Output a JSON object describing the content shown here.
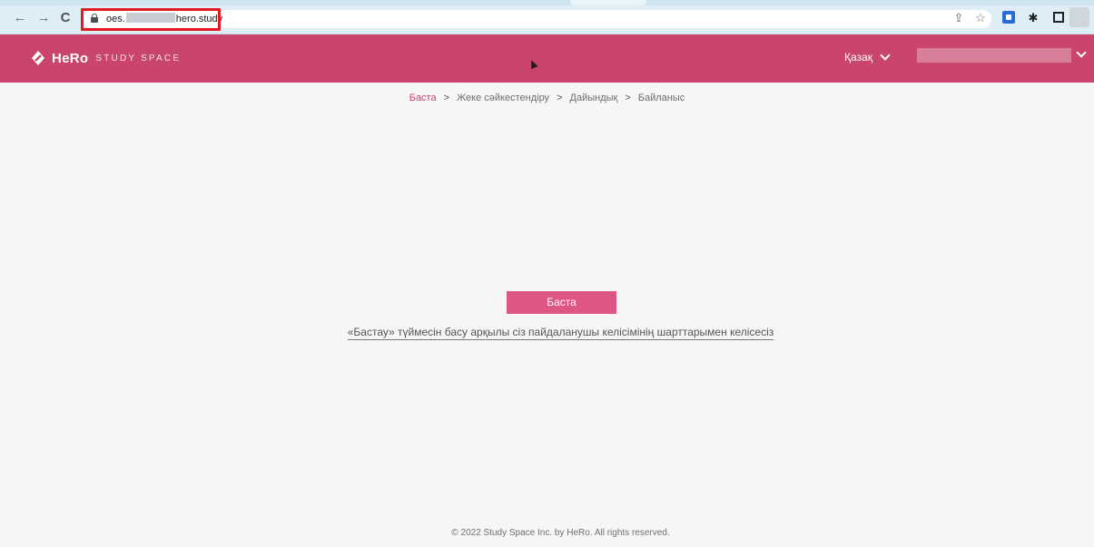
{
  "browser": {
    "url_prefix": "oes.",
    "url_suffix": "hero.study",
    "icons": [
      "back-icon",
      "forward-icon",
      "reload-icon",
      "lock-icon",
      "share-icon",
      "star-icon",
      "extension-icon",
      "puzzle-icon",
      "sidebar-icon",
      "profile-icon"
    ]
  },
  "header": {
    "brand": "HeRo",
    "brand_sub": "STUDY SPACE",
    "language": "Қазақ",
    "accent_color": "#c9456d"
  },
  "breadcrumb": {
    "items": [
      "Баста",
      "Жеке сәйкестендіру",
      "Дайындық",
      "Байланыс"
    ],
    "separator": ">"
  },
  "main": {
    "start_button": "Баста",
    "terms_text": "«Бастау» түймесін басу арқылы сіз пайдаланушы келісімінің шарттарымен келісесіз"
  },
  "footer": {
    "copyright": "© 2022 Study Space Inc. by HeRo. All rights reserved."
  }
}
